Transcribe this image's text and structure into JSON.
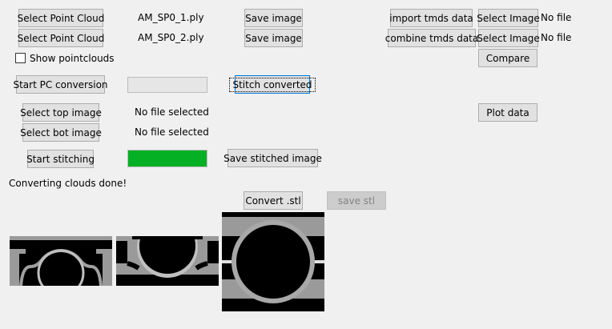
{
  "row1": {
    "select_cloud": "Select Point Cloud",
    "file": "AM_SP0_1.ply",
    "save_image": "Save image",
    "import_tmds": "import tmds data",
    "select_image": "Select Image",
    "image_status": "No file"
  },
  "row2": {
    "select_cloud": "Select Point Cloud",
    "file": "AM_SP0_2.ply",
    "save_image": "Save image",
    "combine_tmds": "combine tmds data",
    "select_image": "Select Image",
    "image_status": "No file"
  },
  "show_pointclouds": {
    "label": "Show pointclouds",
    "checked": false
  },
  "compare": "Compare",
  "start_pc_conversion": "Start PC conversion",
  "stitch_converted": "Stitch converted",
  "select_top_image": "Select top image",
  "top_status": "No file selected",
  "plot_data": "Plot data",
  "select_bot_image": "Select bot image",
  "bot_status": "No file selected",
  "start_stitching": "Start stitching",
  "stitch_progress": 1.0,
  "progress_color": "#06b025",
  "save_stitched_image": "Save stitched image",
  "status_message": "Converting clouds done!",
  "convert_stl": "Convert .stl",
  "save_stl": "save stl"
}
